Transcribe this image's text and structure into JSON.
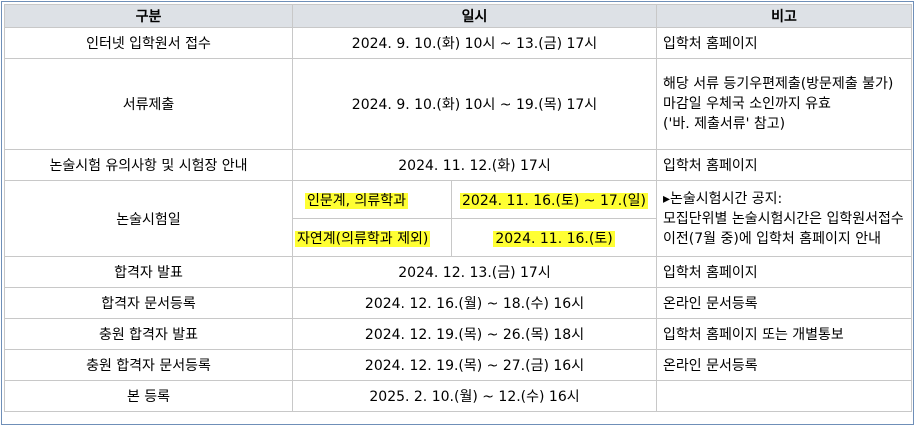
{
  "headers": {
    "col1": "구분",
    "col2": "일시",
    "col3": "비고"
  },
  "rows": {
    "r1": {
      "category": "인터넷 입학원서 접수",
      "date": "2024. 9. 10.(화) 10시 ~ 13.(금) 17시",
      "note": "입학처 홈페이지"
    },
    "r2": {
      "category": "서류제출",
      "date": "2024. 9. 10.(화) 10시 ~ 19.(목) 17시",
      "note_lines": [
        "해당 서류 등기우편제출(방문제출 불가)",
        "마감일 우체국 소인까지 유효",
        "('바. 제출서류' 참고)"
      ]
    },
    "r3": {
      "category": "논술시험 유의사항 및 시험장 안내",
      "date": "2024. 11. 12.(화) 17시",
      "note": "입학처 홈페이지"
    },
    "r4": {
      "category": "논술시험일",
      "sub1": {
        "group": "인문계, 의류학과",
        "date": "2024. 11. 16.(토) ~ 17.(일)"
      },
      "sub2": {
        "group": "자연계(의류학과 제외)",
        "date": "2024. 11. 16.(토)"
      },
      "note_lines": [
        "▸논술시험시간 공지:",
        "모집단위별 논술시험시간은 입학원서접수",
        "이전(7월 중)에 입학처 홈페이지 안내"
      ]
    },
    "r5": {
      "category": "합격자 발표",
      "date": "2024. 12. 13.(금) 17시",
      "note": "입학처 홈페이지"
    },
    "r6": {
      "category": "합격자 문서등록",
      "date": "2024. 12. 16.(월) ~ 18.(수) 16시",
      "note": "온라인 문서등록"
    },
    "r7": {
      "category": "충원 합격자 발표",
      "date": "2024. 12. 19.(목) ~ 26.(목) 18시",
      "note": "입학처 홈페이지 또는 개별통보"
    },
    "r8": {
      "category": "충원 합격자 문서등록",
      "date": "2024. 12. 19.(목) ~ 27.(금) 16시",
      "note": "온라인 문서등록"
    },
    "r9": {
      "category": "본 등록",
      "date": "2025. 2. 10.(월) ~ 12.(수) 16시",
      "note": ""
    }
  }
}
